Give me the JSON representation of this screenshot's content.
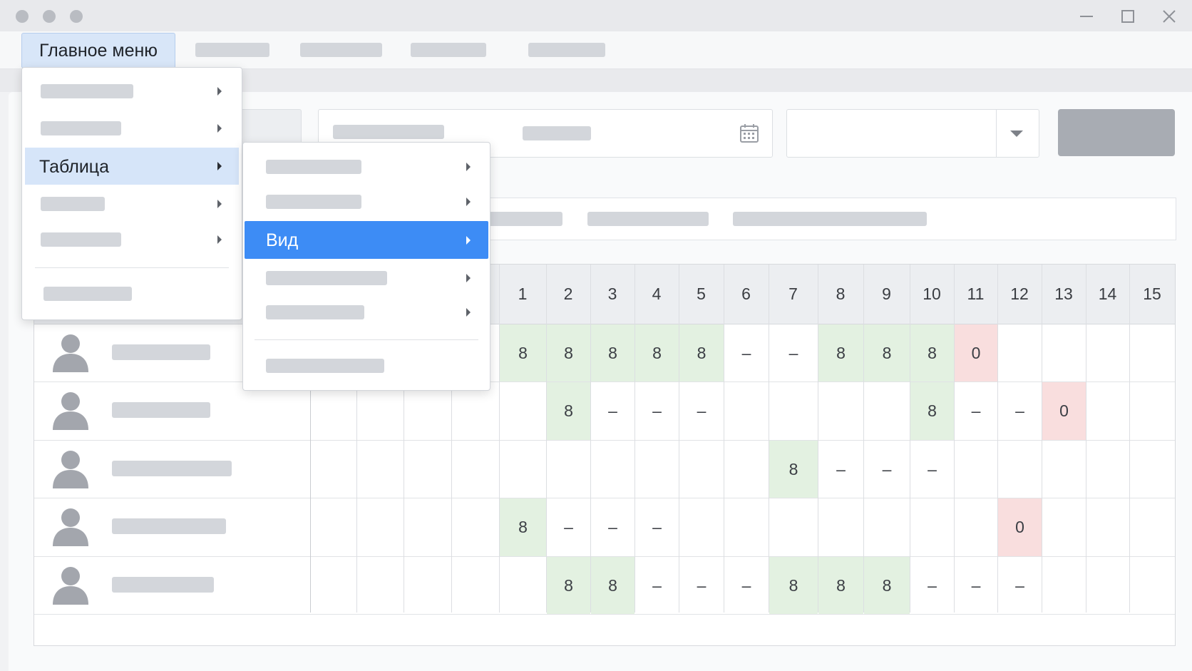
{
  "menubar": {
    "main_menu": "Главное меню"
  },
  "menu_level1": {
    "highlighted": "Таблица"
  },
  "menu_level2": {
    "highlighted": "Вид"
  },
  "colors": {
    "workday_green": "#e3f1e1",
    "absence_red": "#f9dede",
    "highlight_blue": "#3d8cf5",
    "highlight_light": "#d6e5f9"
  },
  "table": {
    "days": [
      "1",
      "2",
      "3",
      "4",
      "5",
      "6",
      "7",
      "8",
      "9",
      "10",
      "11",
      "12",
      "13",
      "14",
      "15"
    ],
    "rows": [
      {
        "cells": [
          {
            "v": "8",
            "s": "g"
          },
          {
            "v": "8",
            "s": "g"
          },
          {
            "v": "8",
            "s": "g"
          },
          {
            "v": "8",
            "s": "g"
          },
          {
            "v": "8",
            "s": "g"
          },
          {
            "v": "–",
            "s": ""
          },
          {
            "v": "–",
            "s": ""
          },
          {
            "v": "8",
            "s": "g"
          },
          {
            "v": "8",
            "s": "g"
          },
          {
            "v": "8",
            "s": "g"
          },
          {
            "v": "0",
            "s": "r"
          },
          {
            "v": "",
            "s": ""
          },
          {
            "v": "",
            "s": ""
          },
          {
            "v": "",
            "s": ""
          },
          {
            "v": "",
            "s": ""
          }
        ]
      },
      {
        "cells": [
          {
            "v": "",
            "s": ""
          },
          {
            "v": "8",
            "s": "g"
          },
          {
            "v": "–",
            "s": ""
          },
          {
            "v": "–",
            "s": ""
          },
          {
            "v": "–",
            "s": ""
          },
          {
            "v": "",
            "s": ""
          },
          {
            "v": "",
            "s": ""
          },
          {
            "v": "",
            "s": ""
          },
          {
            "v": "",
            "s": ""
          },
          {
            "v": "8",
            "s": "g"
          },
          {
            "v": "–",
            "s": ""
          },
          {
            "v": "–",
            "s": ""
          },
          {
            "v": "0",
            "s": "r"
          },
          {
            "v": "",
            "s": ""
          },
          {
            "v": "",
            "s": ""
          }
        ]
      },
      {
        "cells": [
          {
            "v": "",
            "s": ""
          },
          {
            "v": "",
            "s": ""
          },
          {
            "v": "",
            "s": ""
          },
          {
            "v": "",
            "s": ""
          },
          {
            "v": "",
            "s": ""
          },
          {
            "v": "",
            "s": ""
          },
          {
            "v": "8",
            "s": "g"
          },
          {
            "v": "–",
            "s": ""
          },
          {
            "v": "–",
            "s": ""
          },
          {
            "v": "–",
            "s": ""
          },
          {
            "v": "",
            "s": ""
          },
          {
            "v": "",
            "s": ""
          },
          {
            "v": "",
            "s": ""
          },
          {
            "v": "",
            "s": ""
          },
          {
            "v": "",
            "s": ""
          }
        ]
      },
      {
        "cells": [
          {
            "v": "8",
            "s": "g"
          },
          {
            "v": "–",
            "s": ""
          },
          {
            "v": "–",
            "s": ""
          },
          {
            "v": "–",
            "s": ""
          },
          {
            "v": "",
            "s": ""
          },
          {
            "v": "",
            "s": ""
          },
          {
            "v": "",
            "s": ""
          },
          {
            "v": "",
            "s": ""
          },
          {
            "v": "",
            "s": ""
          },
          {
            "v": "",
            "s": ""
          },
          {
            "v": "",
            "s": ""
          },
          {
            "v": "0",
            "s": "r"
          },
          {
            "v": "",
            "s": ""
          },
          {
            "v": "",
            "s": ""
          },
          {
            "v": "",
            "s": ""
          }
        ]
      },
      {
        "cells": [
          {
            "v": "",
            "s": ""
          },
          {
            "v": "8",
            "s": "g"
          },
          {
            "v": "8",
            "s": "g"
          },
          {
            "v": "–",
            "s": ""
          },
          {
            "v": "–",
            "s": ""
          },
          {
            "v": "–",
            "s": ""
          },
          {
            "v": "8",
            "s": "g"
          },
          {
            "v": "8",
            "s": "g"
          },
          {
            "v": "8",
            "s": "g"
          },
          {
            "v": "–",
            "s": ""
          },
          {
            "v": "–",
            "s": ""
          },
          {
            "v": "–",
            "s": ""
          },
          {
            "v": "",
            "s": ""
          },
          {
            "v": "",
            "s": ""
          },
          {
            "v": "",
            "s": ""
          }
        ]
      }
    ]
  }
}
